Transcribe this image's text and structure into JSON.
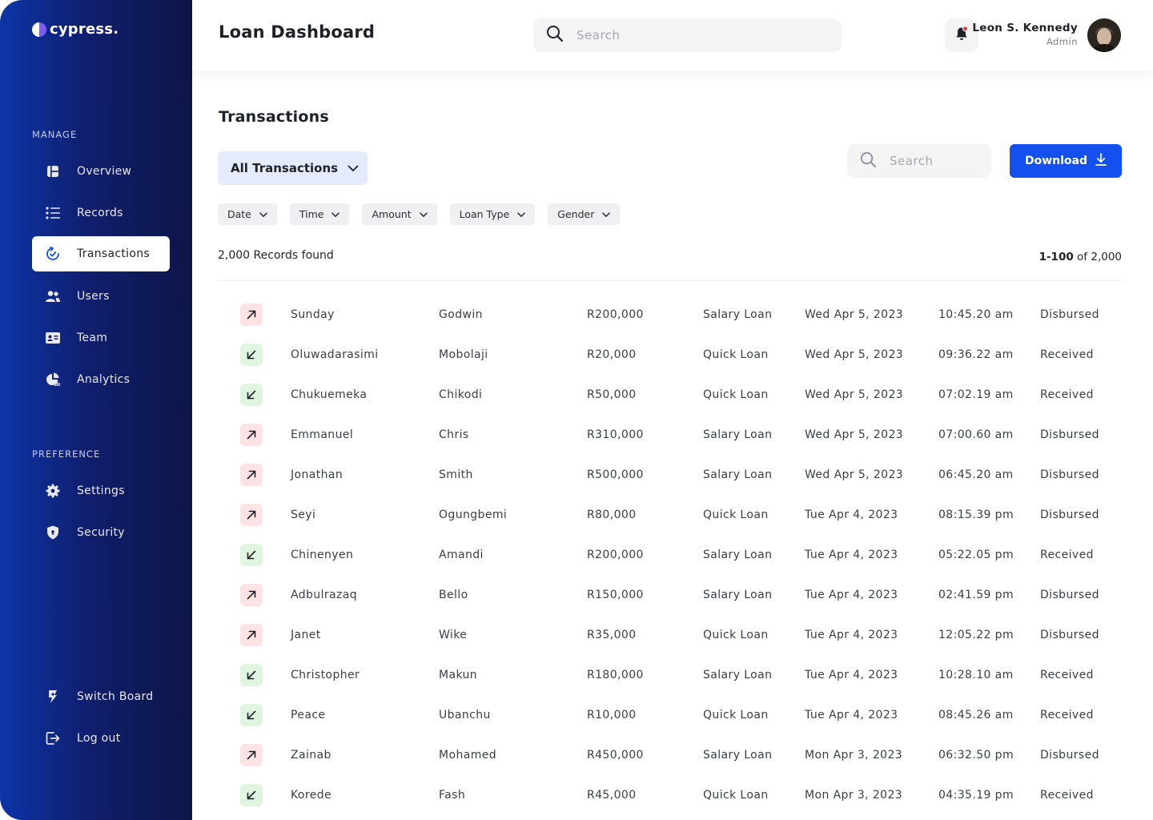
{
  "brand": {
    "name": "cypress."
  },
  "sidebar": {
    "manage_label": "MANAGE",
    "preference_label": "PREFERENCE",
    "items": [
      {
        "label": "Overview",
        "icon": "overview-icon"
      },
      {
        "label": "Records",
        "icon": "list-icon"
      },
      {
        "label": "Transactions",
        "icon": "transactions-icon",
        "active": true
      },
      {
        "label": "Users",
        "icon": "users-icon"
      },
      {
        "label": "Team",
        "icon": "id-card-icon"
      },
      {
        "label": "Analytics",
        "icon": "pie-chart-icon"
      }
    ],
    "pref_items": [
      {
        "label": "Settings",
        "icon": "gear-icon"
      },
      {
        "label": "Security",
        "icon": "shield-icon"
      }
    ],
    "bottom_items": [
      {
        "label": "Switch Board",
        "icon": "switch-icon"
      },
      {
        "label": "Log out",
        "icon": "logout-icon"
      }
    ]
  },
  "header": {
    "title": "Loan Dashboard",
    "search_placeholder": "Search",
    "user": {
      "name": "Leon S. Kennedy",
      "role": "Admin"
    }
  },
  "transactions": {
    "title": "Transactions",
    "filter_select": "All Transactions",
    "search_placeholder": "Search",
    "download_label": "Download",
    "filters": [
      "Date",
      "Time",
      "Amount",
      "Loan Type",
      "Gender"
    ],
    "records_found": "2,000 Records found",
    "pagination": {
      "range": "1-100",
      "of": "of 2,000"
    },
    "rows": [
      {
        "dir": "out",
        "first": "Sunday",
        "last": "Godwin",
        "amount": "R200,000",
        "type": "Salary Loan",
        "date": "Wed Apr 5, 2023",
        "time": "10:45.20 am",
        "status": "Disbursed"
      },
      {
        "dir": "in",
        "first": "Oluwadarasimi",
        "last": "Mobolaji",
        "amount": "R20,000",
        "type": "Quick Loan",
        "date": "Wed Apr 5, 2023",
        "time": "09:36.22 am",
        "status": "Received"
      },
      {
        "dir": "in",
        "first": "Chukuemeka",
        "last": "Chikodi",
        "amount": "R50,000",
        "type": "Quick Loan",
        "date": "Wed Apr 5, 2023",
        "time": "07:02.19 am",
        "status": "Received"
      },
      {
        "dir": "out",
        "first": "Emmanuel",
        "last": "Chris",
        "amount": "R310,000",
        "type": "Salary Loan",
        "date": "Wed Apr 5, 2023",
        "time": "07:00.60 am",
        "status": "Disbursed"
      },
      {
        "dir": "out",
        "first": "Jonathan",
        "last": "Smith",
        "amount": "R500,000",
        "type": "Salary Loan",
        "date": "Wed Apr 5, 2023",
        "time": "06:45.20 am",
        "status": "Disbursed"
      },
      {
        "dir": "out",
        "first": "Seyi",
        "last": "Ogungbemi",
        "amount": "R80,000",
        "type": "Quick Loan",
        "date": "Tue Apr 4, 2023",
        "time": "08:15.39 pm",
        "status": "Disbursed"
      },
      {
        "dir": "in",
        "first": "Chinenyen",
        "last": "Amandi",
        "amount": "R200,000",
        "type": "Salary Loan",
        "date": "Tue Apr 4, 2023",
        "time": "05:22.05 pm",
        "status": "Received"
      },
      {
        "dir": "out",
        "first": "Adbulrazaq",
        "last": "Bello",
        "amount": "R150,000",
        "type": "Salary Loan",
        "date": "Tue Apr 4, 2023",
        "time": "02:41.59 pm",
        "status": "Disbursed"
      },
      {
        "dir": "out",
        "first": "Janet",
        "last": "Wike",
        "amount": "R35,000",
        "type": "Quick Loan",
        "date": "Tue Apr 4, 2023",
        "time": "12:05.22 pm",
        "status": "Disbursed"
      },
      {
        "dir": "in",
        "first": "Christopher",
        "last": "Makun",
        "amount": "R180,000",
        "type": "Salary Loan",
        "date": "Tue Apr 4, 2023",
        "time": "10:28.10 am",
        "status": "Received"
      },
      {
        "dir": "in",
        "first": "Peace",
        "last": "Ubanchu",
        "amount": "R10,000",
        "type": "Quick Loan",
        "date": "Tue Apr 4, 2023",
        "time": "08:45.26 am",
        "status": "Received"
      },
      {
        "dir": "out",
        "first": "Zainab",
        "last": "Mohamed",
        "amount": "R450,000",
        "type": "Salary Loan",
        "date": "Mon Apr 3, 2023",
        "time": "06:32.50 pm",
        "status": "Disbursed"
      },
      {
        "dir": "in",
        "first": "Korede",
        "last": "Fash",
        "amount": "R45,000",
        "type": "Quick Loan",
        "date": "Mon Apr 3, 2023",
        "time": "04:35.19 pm",
        "status": "Received"
      }
    ]
  },
  "colors": {
    "accent": "#1350ee",
    "sidebar_start": "#0c34a8",
    "sidebar_end": "#0d1546",
    "out_bg": "#fde3e3",
    "in_bg": "#dff5df",
    "notification_dot": "#e8322f"
  }
}
